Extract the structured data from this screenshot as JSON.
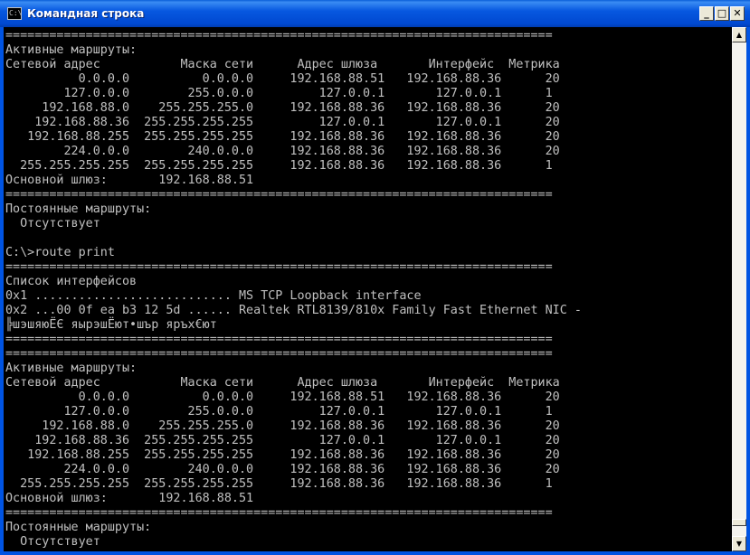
{
  "window": {
    "title": "Командная строка",
    "icon": "cmd-icon",
    "icon_text": "C:\\",
    "minimize_glyph": "_",
    "maximize_glyph": "□",
    "close_glyph": "✕"
  },
  "scrollbar": {
    "up_glyph": "▲",
    "down_glyph": "▼",
    "position": 0.98
  },
  "console": {
    "lines": [
      "===========================================================================",
      "Активные маршруты:",
      "Сетевой адрес           Маска сети      Адрес шлюза       Интерфейс  Метрика",
      "          0.0.0.0          0.0.0.0     192.168.88.51   192.168.88.36      20",
      "        127.0.0.0        255.0.0.0         127.0.0.1       127.0.0.1      1",
      "     192.168.88.0    255.255.255.0     192.168.88.36   192.168.88.36      20",
      "    192.168.88.36  255.255.255.255         127.0.0.1       127.0.0.1      20",
      "   192.168.88.255  255.255.255.255     192.168.88.36   192.168.88.36      20",
      "        224.0.0.0        240.0.0.0     192.168.88.36   192.168.88.36      20",
      "  255.255.255.255  255.255.255.255     192.168.88.36   192.168.88.36      1",
      "Основной шлюз:       192.168.88.51",
      "===========================================================================",
      "Постоянные маршруты:",
      "  Отсутствует",
      "",
      "C:\\>route print",
      "===========================================================================",
      "Список интерфейсов",
      "0x1 ........................... MS TCP Loopback interface",
      "0x2 ...00 0f ea b3 12 5d ...... Realtek RTL8139/810x Family Fast Ethernet NIC -",
      "╠шэшяюЁЄ яырэшЁют•шър яръх€ют",
      "===========================================================================",
      "===========================================================================",
      "Активные маршруты:",
      "Сетевой адрес           Маска сети      Адрес шлюза       Интерфейс  Метрика",
      "          0.0.0.0          0.0.0.0     192.168.88.51   192.168.88.36      20",
      "        127.0.0.0        255.0.0.0         127.0.0.1       127.0.0.1      1",
      "     192.168.88.0    255.255.255.0     192.168.88.36   192.168.88.36      20",
      "    192.168.88.36  255.255.255.255         127.0.0.1       127.0.0.1      20",
      "   192.168.88.255  255.255.255.255     192.168.88.36   192.168.88.36      20",
      "        224.0.0.0        240.0.0.0     192.168.88.36   192.168.88.36      20",
      "  255.255.255.255  255.255.255.255     192.168.88.36   192.168.88.36      1",
      "Основной шлюз:       192.168.88.51",
      "===========================================================================",
      "Постоянные маршруты:",
      "  Отсутствует"
    ]
  },
  "colors": {
    "title_bar": "#0054e3",
    "console_bg": "#000000",
    "console_fg": "#c0c0c0"
  }
}
